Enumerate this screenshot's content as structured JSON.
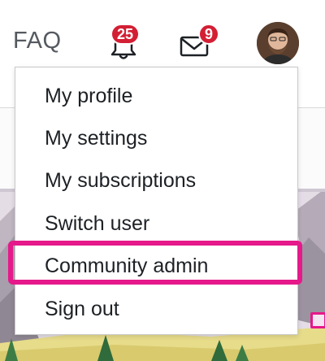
{
  "nav": {
    "faq_label": "FAQ",
    "notifications_count": "25",
    "messages_count": "9",
    "icons": {
      "notifications": "bell-icon",
      "messages": "envelope-icon",
      "avatar": "user-avatar"
    }
  },
  "user_menu": {
    "items": [
      {
        "label": "My profile"
      },
      {
        "label": "My settings"
      },
      {
        "label": "My subscriptions"
      },
      {
        "label": "Switch user"
      },
      {
        "label": "Community admin",
        "highlighted": true
      },
      {
        "label": "Sign out"
      }
    ]
  },
  "colors": {
    "badge": "#d31f34",
    "highlight": "#e5198a",
    "text": "#1d2125",
    "nav_text": "#555a60"
  }
}
